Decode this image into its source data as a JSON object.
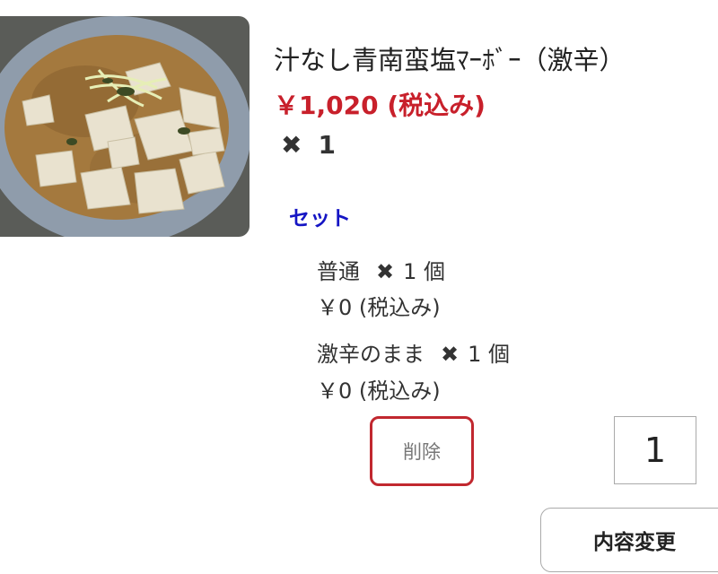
{
  "item": {
    "image_alt": "mapo tofu photo",
    "title": "汁なし青南蛮塩ﾏｰﾎﾞｰ（激辛）",
    "price": "￥1,020 (税込み)",
    "quantity_icon": "x-icon",
    "quantity": "1"
  },
  "set": {
    "label": "セット",
    "options": [
      {
        "name": "普通",
        "count": "1 個",
        "price": "￥0 (税込み)"
      },
      {
        "name": "激辛のまま",
        "count": "1 個",
        "price": "￥0 (税込み)"
      }
    ]
  },
  "actions": {
    "delete_label": "削除",
    "quantity_value": "1",
    "change_label": "内容変更"
  },
  "colors": {
    "price": "#c8202b",
    "section_label": "#1515c4",
    "delete_border": "#c1282f"
  }
}
